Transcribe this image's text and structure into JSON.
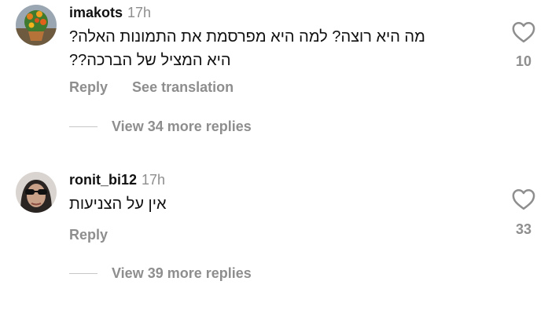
{
  "comments": [
    {
      "username": "imakots",
      "time": "17h",
      "text_lines": [
        "מה היא רוצה? למה היא מפרסמת את התמונות האלה?",
        "היא המציל של הברכה??"
      ],
      "reply_label": "Reply",
      "translate_label": "See translation",
      "likes": "10",
      "view_replies": "View 34 more replies"
    },
    {
      "username": "ronit_bi12",
      "time": "17h",
      "text_lines": [
        "אין על הצניעות"
      ],
      "reply_label": "Reply",
      "likes": "33",
      "view_replies": "View 39 more replies"
    }
  ],
  "colors": {
    "secondary_text": "#8e8e8e",
    "primary_text": "#111111",
    "divider": "#c7c7c7"
  },
  "icons": {
    "like": "heart-outline-icon"
  }
}
